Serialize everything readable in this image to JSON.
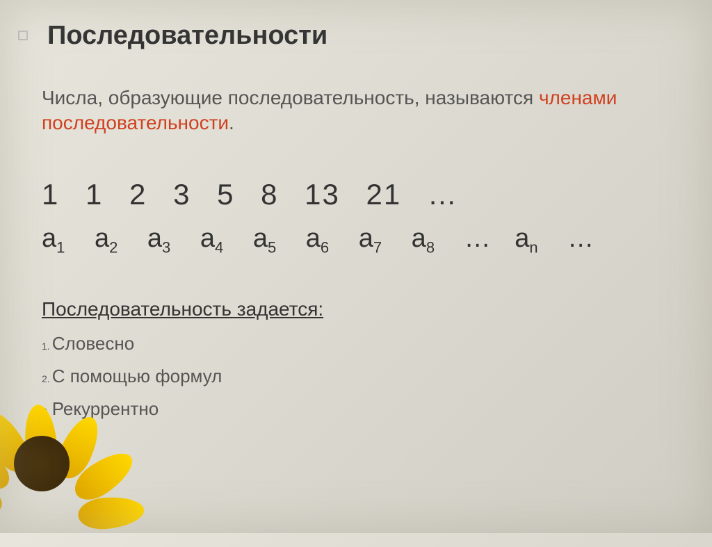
{
  "title": "Последовательности",
  "definition_part1": "Числа, образующие последовательность, называются ",
  "definition_highlight": "членами последовательности",
  "definition_period": ".",
  "sequence_numbers": "1   1   2   3   5   8   13    21 …",
  "terms": [
    {
      "base": "a",
      "sub": "1"
    },
    {
      "base": "a",
      "sub": "2"
    },
    {
      "base": "a",
      "sub": "3"
    },
    {
      "base": "a",
      "sub": "4"
    },
    {
      "base": "a",
      "sub": "5"
    },
    {
      "base": "a",
      "sub": "6"
    },
    {
      "base": "a",
      "sub": "7"
    },
    {
      "base": "a",
      "sub": "8"
    }
  ],
  "ellipsis1": "…",
  "term_n": {
    "base": "a",
    "sub": "n"
  },
  "ellipsis2": "…",
  "methods_title": "Последовательность задается:",
  "methods": [
    {
      "num": "1.",
      "text": "Словесно"
    },
    {
      "num": "2.",
      "text": "С помощью формул"
    },
    {
      "num": "3.",
      "text": "Рекуррентно"
    }
  ]
}
